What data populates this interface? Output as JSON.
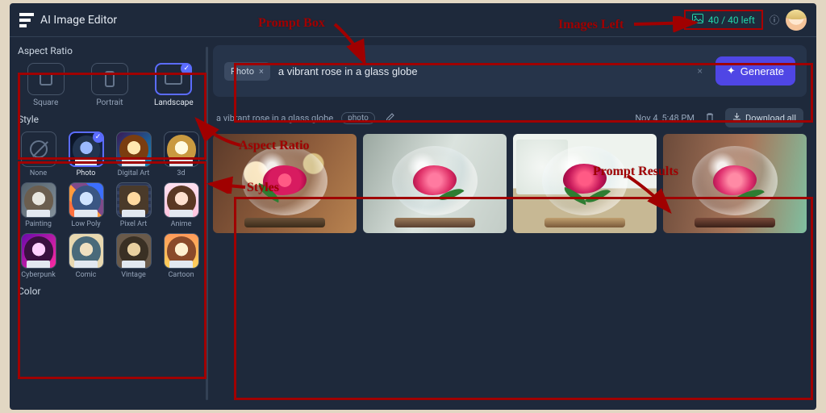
{
  "header": {
    "title": "AI Image Editor",
    "credits": "40 / 40 left"
  },
  "sidebar": {
    "aspect": {
      "title": "Aspect Ratio",
      "items": [
        {
          "label": "Square"
        },
        {
          "label": "Portrait"
        },
        {
          "label": "Landscape"
        }
      ]
    },
    "style": {
      "title": "Style",
      "items": [
        {
          "label": "None"
        },
        {
          "label": "Photo"
        },
        {
          "label": "Digital Art"
        },
        {
          "label": "3d"
        },
        {
          "label": "Painting"
        },
        {
          "label": "Low Poly"
        },
        {
          "label": "Pixel Art"
        },
        {
          "label": "Anime"
        },
        {
          "label": "Cyberpunk"
        },
        {
          "label": "Comic"
        },
        {
          "label": "Vintage"
        },
        {
          "label": "Cartoon"
        }
      ]
    },
    "color": {
      "title": "Color"
    }
  },
  "prompt": {
    "chip": "Photo",
    "text": "a vibrant rose in a glass globe",
    "generate": "Generate"
  },
  "results": {
    "prompt": "a vibrant rose in a glass globe",
    "tag": "photo",
    "time": "Nov 4, 5:48 PM",
    "download": "Download all"
  },
  "annotations": {
    "prompt_box": "Prompt Box",
    "images_left": "Images Left",
    "aspect_ratio": "Aspect Ratio",
    "styles": "Styles",
    "prompt_results": "Prompt Results"
  }
}
